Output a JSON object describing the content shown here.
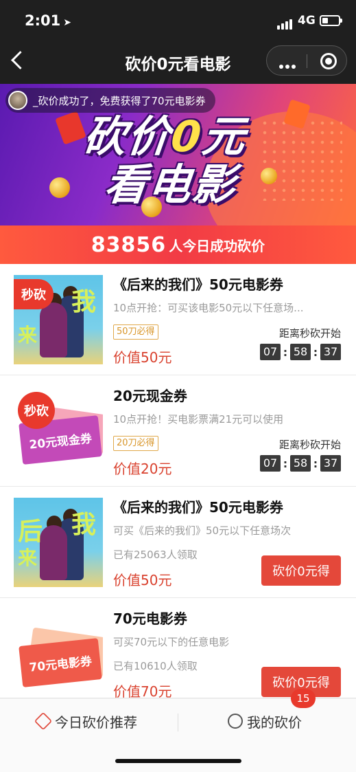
{
  "status": {
    "time": "2:01",
    "network": "4G"
  },
  "nav": {
    "title": "砍价0元看电影"
  },
  "banner": {
    "notice": "_砍价成功了，免费获得了70元电影券",
    "title_line1_a": "砍价",
    "title_line1_b": "0",
    "title_line1_c": "元",
    "title_line2": "看电影",
    "count": "83856",
    "count_suffix": "人今日成功砍价"
  },
  "items": [
    {
      "title": "《后来的我们》50元电影券",
      "desc": "10点开抢：可买该电影50元以下任意场...",
      "tag": "50刀必得",
      "price": "价值50元",
      "flash": "秒砍",
      "countdown_label": "距离秒砍开始",
      "countdown": [
        "07",
        "58",
        "37"
      ]
    },
    {
      "title": "20元现金券",
      "desc": "10点开抢！买电影票满21元可以使用",
      "tag": "20刀必得",
      "price": "价值20元",
      "flash": "秒砍",
      "ticket_text": "20元现金券",
      "countdown_label": "距离秒砍开始",
      "countdown": [
        "07",
        "58",
        "37"
      ]
    },
    {
      "title": "《后来的我们》50元电影券",
      "desc": "可买《后来的我们》50元以下任意场次",
      "joined": "已有25063人领取",
      "price": "价值50元",
      "button": "砍价0元得"
    },
    {
      "title": "70元电影券",
      "desc": "可买70元以下的任意电影",
      "joined": "已有10610人领取",
      "price": "价值70元",
      "ticket_text": "70元电影券",
      "button": "砍价0元得"
    }
  ],
  "tabbar": {
    "tab1": "今日砍价推荐",
    "tab2": "我的砍价",
    "badge": "15"
  },
  "colors": {
    "accent": "#e4483a",
    "nav_bg": "#1f1f1f",
    "price": "#d9412e"
  }
}
